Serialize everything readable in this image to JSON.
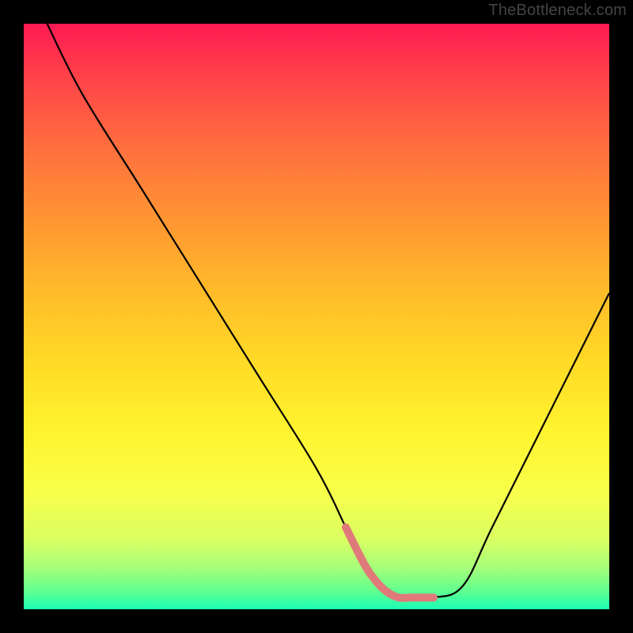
{
  "watermark": "TheBottleneck.com",
  "chart_data": {
    "type": "line",
    "title": "",
    "xlabel": "",
    "ylabel": "",
    "xlim": [
      0,
      100
    ],
    "ylim": [
      0,
      100
    ],
    "grid": false,
    "background_gradient": {
      "stops": [
        {
          "pos": 0,
          "color": "#ff1a52"
        },
        {
          "pos": 20,
          "color": "#ff6b3f"
        },
        {
          "pos": 45,
          "color": "#ffb92a"
        },
        {
          "pos": 70,
          "color": "#fff430"
        },
        {
          "pos": 88,
          "color": "#daff62"
        },
        {
          "pos": 100,
          "color": "#1cffb7"
        }
      ]
    },
    "series": [
      {
        "name": "curve",
        "color": "#000000",
        "x": [
          4,
          10,
          20,
          30,
          40,
          50,
          55,
          58,
          62,
          66,
          70,
          75,
          80,
          88,
          96,
          100
        ],
        "values": [
          100,
          88,
          72,
          56,
          40,
          24,
          14,
          8,
          3,
          2,
          2,
          4,
          14,
          30,
          46,
          54
        ]
      },
      {
        "name": "highlight-segment",
        "color": "#e07a7a",
        "thick": true,
        "x": [
          55,
          58,
          60,
          62,
          64,
          66,
          68,
          70
        ],
        "values": [
          14,
          8,
          5,
          3,
          2,
          2,
          2,
          2
        ]
      }
    ]
  }
}
